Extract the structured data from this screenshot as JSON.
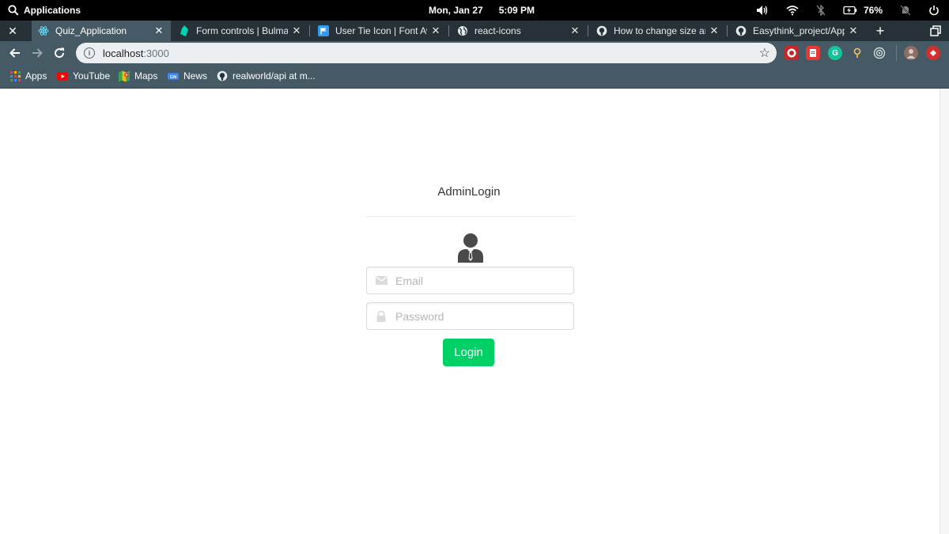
{
  "os_bar": {
    "activities_label": "Applications",
    "date": "Mon, Jan 27",
    "time": "5:09 PM",
    "battery_percent": "76%"
  },
  "tabs": [
    {
      "title": "Quiz_Application",
      "icon": "react-icon",
      "active": true
    },
    {
      "title": "Form controls | Bulma: F",
      "icon": "bulma-icon",
      "active": false
    },
    {
      "title": "User Tie Icon | Font Awe",
      "icon": "font-awesome-flag-icon",
      "active": false
    },
    {
      "title": "react-icons",
      "icon": "globe-icon",
      "active": false
    },
    {
      "title": "How to change size and",
      "icon": "github-icon",
      "active": false
    },
    {
      "title": "Easythink_project/App.js",
      "icon": "github-icon",
      "active": false
    }
  ],
  "address_bar": {
    "host": "localhost",
    "port": ":3000"
  },
  "bookmarks": [
    {
      "label": "Apps",
      "icon": "apps-grid-icon"
    },
    {
      "label": "YouTube",
      "icon": "youtube-icon"
    },
    {
      "label": "Maps",
      "icon": "maps-icon"
    },
    {
      "label": "News",
      "icon": "news-icon"
    },
    {
      "label": "realworld/api at m...",
      "icon": "github-icon"
    }
  ],
  "login": {
    "title": "AdminLogin",
    "email_placeholder": "Email",
    "password_placeholder": "Password",
    "button_label": "Login",
    "button_color": "#00d167"
  }
}
